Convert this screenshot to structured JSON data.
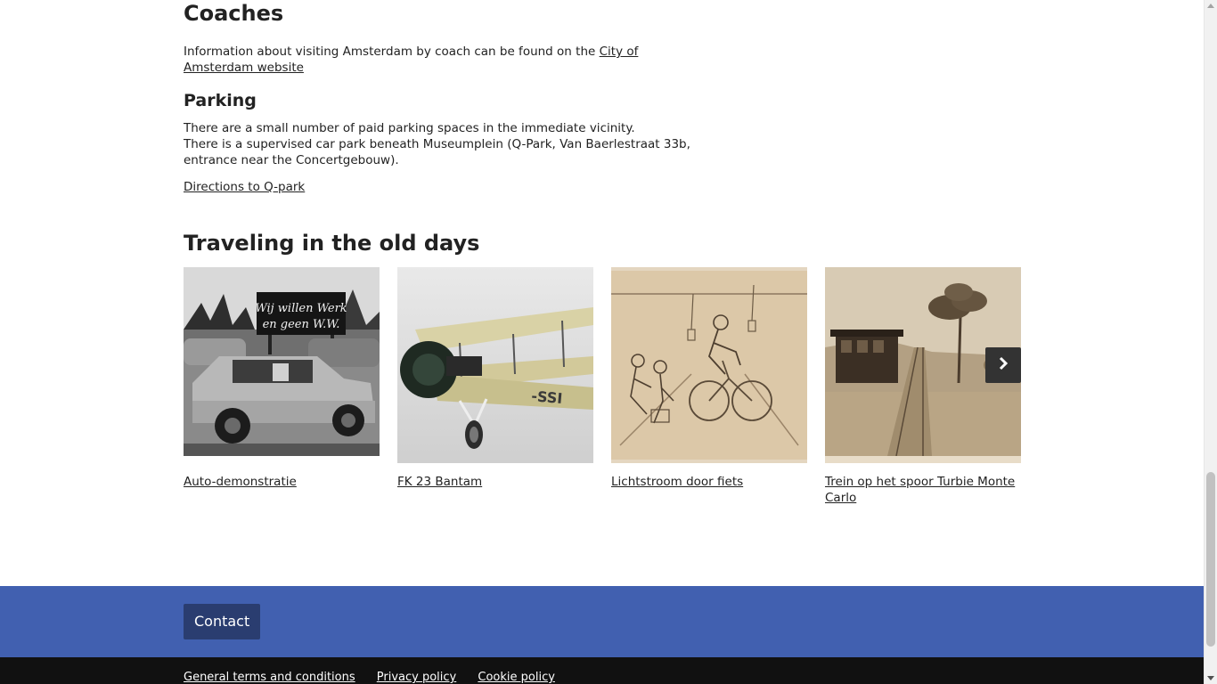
{
  "coaches": {
    "heading": "Coaches",
    "text_before_link": "Information about visiting Amsterdam by coach can be found on the ",
    "link_text": "City of Amsterdam website"
  },
  "parking": {
    "heading": "Parking",
    "line1": "There are a small number of paid parking spaces in the immediate vicinity.",
    "line2": "There is a supervised car park beneath Museumplein (Q-Park, Van Baerlestraat 33b, entrance near the Concertgebouw).",
    "directions_link": "Directions to Q-park"
  },
  "traveling": {
    "heading": "Traveling in the old days",
    "cards": [
      {
        "caption": "Auto-demonstratie",
        "image_sign_text_1": "Wij willen Werk",
        "image_sign_text_2": "en geen W.W."
      },
      {
        "caption": "FK 23 Bantam"
      },
      {
        "caption": "Lichtstroom door fiets"
      },
      {
        "caption": "Trein op het spoor Turbie Monte Carlo"
      }
    ],
    "next_icon": "chevron-right-icon"
  },
  "footer": {
    "contact_label": "Contact",
    "links": [
      "General terms and conditions",
      "Privacy policy",
      "Cookie policy"
    ],
    "blue_color": "#4160b0",
    "button_color": "#2a3d70",
    "dark_color": "#111111"
  }
}
